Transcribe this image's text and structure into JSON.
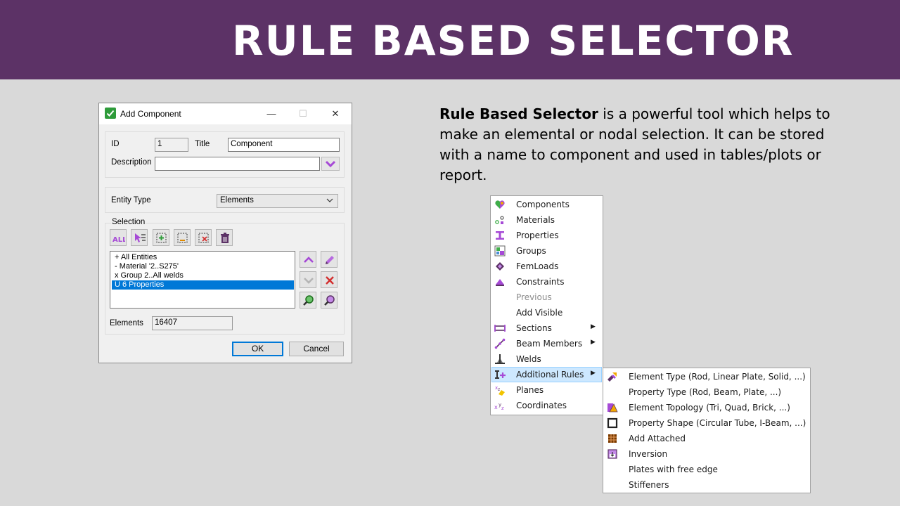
{
  "banner": {
    "title": "RULE BASED SELECTOR"
  },
  "dialog": {
    "title": "Add Component",
    "id_label": "ID",
    "id_value": "1",
    "title_label": "Title",
    "title_value": "Component",
    "description_label": "Description",
    "description_value": "",
    "entity_type_label": "Entity Type",
    "entity_type_value": "Elements",
    "selection_label": "Selection",
    "selection_items": [
      "+ All Entities",
      "- Material '2..S275'",
      "x Group 2..All welds",
      "U 6 Properties"
    ],
    "selected_index": 3,
    "elements_label": "Elements",
    "elements_value": "16407",
    "ok_label": "OK",
    "cancel_label": "Cancel"
  },
  "description": {
    "bold": "Rule Based Selector",
    "rest": " is a powerful tool which helps to make an elemental or nodal selection. It can be stored with a name to component and used in tables/plots or report."
  },
  "context_menu": {
    "items": [
      {
        "label": "Components",
        "icon": "components-icon"
      },
      {
        "label": "Materials",
        "icon": "materials-icon"
      },
      {
        "label": "Properties",
        "icon": "properties-icon"
      },
      {
        "label": "Groups",
        "icon": "groups-icon"
      },
      {
        "label": "FemLoads",
        "icon": "femloads-icon"
      },
      {
        "label": "Constraints",
        "icon": "constraints-icon"
      },
      {
        "label": "Previous",
        "icon": "",
        "disabled": true
      },
      {
        "label": "Add Visible",
        "icon": ""
      },
      {
        "label": "Sections",
        "icon": "sections-icon",
        "submenu": true
      },
      {
        "label": "Beam Members",
        "icon": "beam-members-icon",
        "submenu": true
      },
      {
        "label": "Welds",
        "icon": "welds-icon"
      },
      {
        "label": "Additional Rules",
        "icon": "additional-rules-icon",
        "submenu": true,
        "highlighted": true
      },
      {
        "label": "Planes",
        "icon": "planes-icon"
      },
      {
        "label": "Coordinates",
        "icon": "coordinates-icon"
      }
    ]
  },
  "submenu": {
    "items": [
      {
        "label": "Element Type (Rod, Linear Plate, Solid, ...)",
        "icon": "element-type-icon"
      },
      {
        "label": "Property Type (Rod, Beam, Plate, ...)",
        "icon": ""
      },
      {
        "label": "Element Topology (Tri, Quad, Brick, ...)",
        "icon": "element-topology-icon"
      },
      {
        "label": "Property Shape (Circular Tube, I-Beam, ...)",
        "icon": "property-shape-icon"
      },
      {
        "label": "Add Attached",
        "icon": "add-attached-icon"
      },
      {
        "label": "Inversion",
        "icon": "inversion-icon"
      },
      {
        "label": "Plates with free edge",
        "icon": ""
      },
      {
        "label": "Stiffeners",
        "icon": ""
      }
    ]
  },
  "colors": {
    "banner": "#5c3266",
    "background": "#d9d9d9",
    "selection": "#0078d7",
    "icon_purple": "#a64ad6"
  }
}
